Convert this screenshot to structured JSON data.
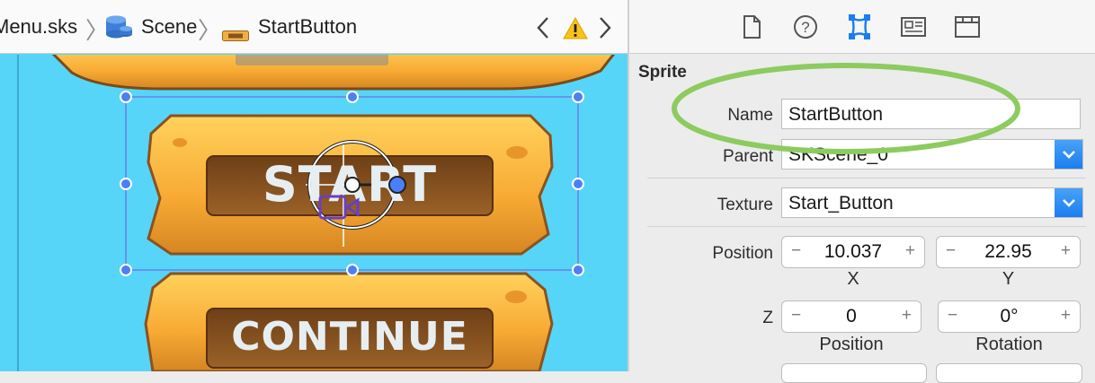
{
  "jumpbar": {
    "file": "Menu.sks",
    "scene": "Scene",
    "node": "StartButton"
  },
  "canvas": {
    "start_text": "START",
    "continue_text": "CONTINUE"
  },
  "inspector": {
    "section_title": "Sprite",
    "name_label": "Name",
    "name_value": "StartButton",
    "parent_label": "Parent",
    "parent_value": "SKScene_0",
    "texture_label": "Texture",
    "texture_value": "Start_Button",
    "position_label": "Position",
    "position_x": "10.037",
    "position_y": "22.95",
    "x_label": "X",
    "y_label": "Y",
    "z_label": "Z",
    "z_position": "0",
    "rotation": "0°",
    "z_position_caption": "Position",
    "rotation_caption": "Rotation",
    "minus_glyph": "−",
    "plus_glyph": "+"
  },
  "colors": {
    "canvas_bg": "#56d5f8",
    "selection": "#4a7ff7",
    "highlight_ellipse": "#8dcb5f",
    "button_orange": "#f7b03c",
    "button_inner": "#8a5220",
    "popup_blue": "#1a7df0"
  },
  "icons": [
    "file-icon",
    "help-icon",
    "node-inspector-icon",
    "attributes-icon",
    "library-icon",
    "warning-icon",
    "chevron-left-icon",
    "chevron-right-icon",
    "scene-icon",
    "sprite-icon",
    "camera-icon"
  ]
}
